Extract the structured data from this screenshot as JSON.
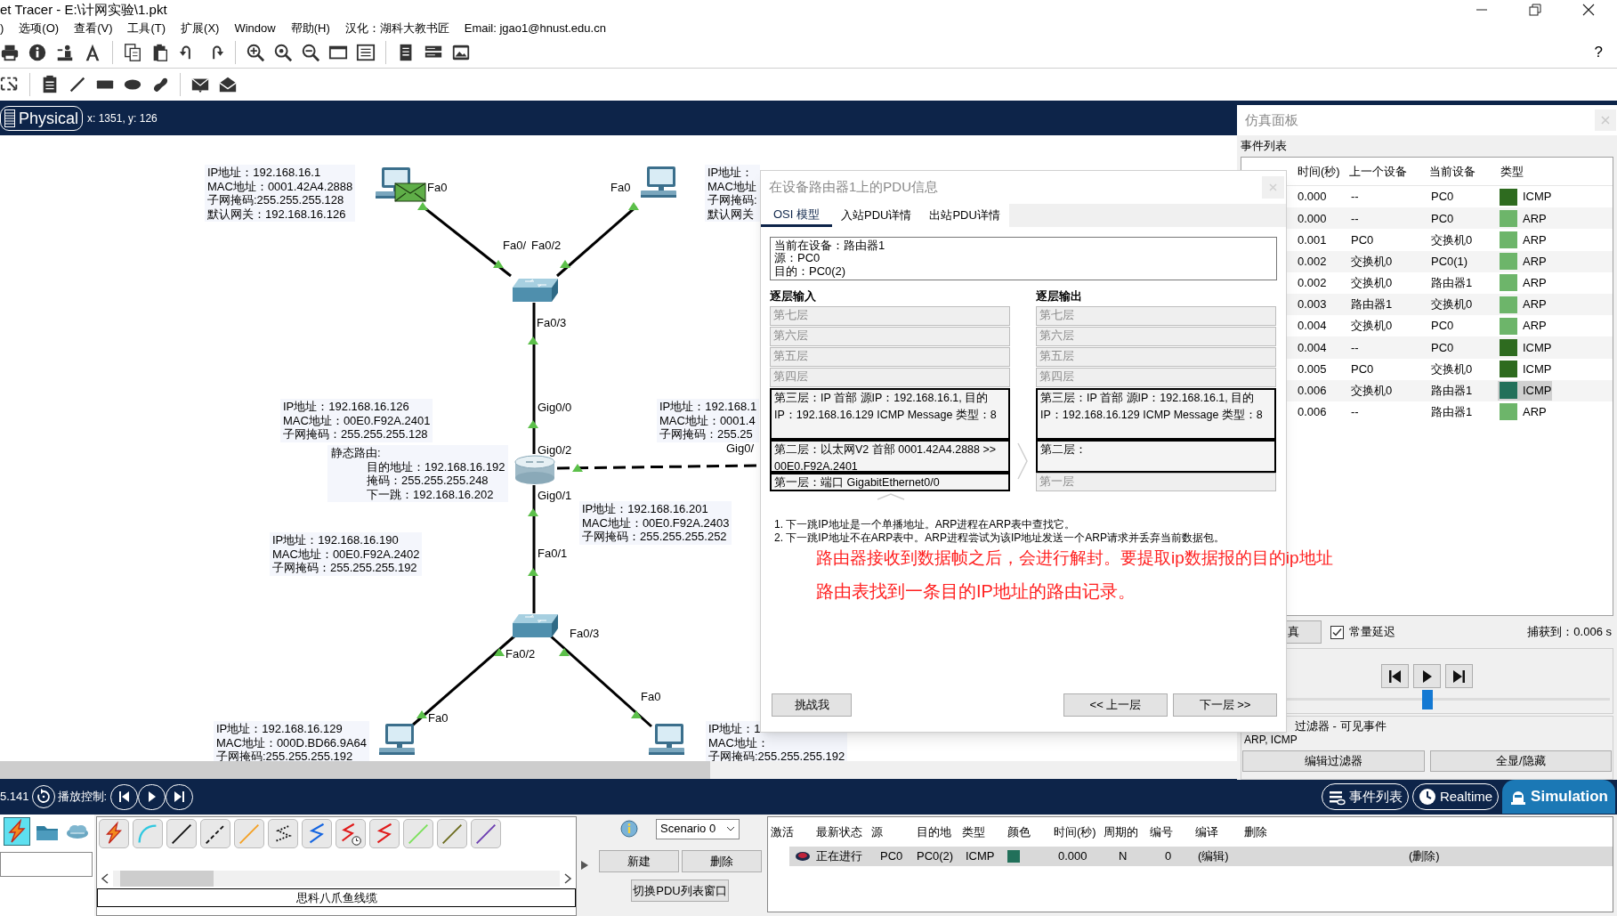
{
  "title_bar": {
    "title": "et Tracer - E:\\计网实验\\1.pkt"
  },
  "menu": [
    ")",
    "选项(O)",
    "查看(V)",
    "工具(T)",
    "扩展(X)",
    "Window",
    "帮助(H)",
    "汉化：湖科大教书匠",
    "Email: jgao1@hnust.edu.cn"
  ],
  "help": "?",
  "workspace_bar": {
    "mode": "Physical",
    "coords": "x: 1351, y: 126"
  },
  "topology": {
    "devices": [
      {
        "kind": "pc",
        "packet": true
      },
      {
        "kind": "pc"
      },
      {
        "kind": "switch"
      },
      {
        "kind": "router"
      },
      {
        "kind": "switch"
      },
      {
        "kind": "pc"
      },
      {
        "kind": "pc"
      }
    ],
    "port_labels": [
      "Fa0",
      "Fa0",
      "Fa0/",
      "Fa0/2",
      "Fa0/3",
      "Gig0/0",
      "Gig0/2",
      "Gig0/1",
      "Fa0/1",
      "Fa0/3",
      "Fa0/2",
      "Fa0",
      "Fa0",
      "Gig0/"
    ],
    "info_labels": [
      {
        "lines": [
          "IP地址：192.168.16.1",
          "MAC地址：0001.42A4.2888",
          "子网掩码:255.255.255.128",
          "默认网关：192.168.16.126"
        ]
      },
      {
        "lines": [
          "IP地址：",
          "MAC地址",
          "子网掩码:",
          "默认网关"
        ]
      },
      {
        "lines": [
          "IP地址：192.168.16.126",
          "MAC地址：00E0.F92A.2401",
          "子网掩码：255.255.255.128"
        ]
      },
      {
        "lines": [
          "IP地址：192.168.1",
          "MAC地址：0001.4",
          "子网掩码：255.25"
        ]
      },
      {
        "lines": [
          "IP地址：192.168.16.190",
          "MAC地址：00E0.F92A.2402",
          "子网掩码：255.255.255.192"
        ]
      },
      {
        "lines": [
          "IP地址：192.168.16.201",
          "MAC地址：00E0.F92A.2403",
          "子网掩码：255.255.255.252"
        ]
      },
      {
        "lines": [
          "IP地址：192.168.16.129",
          "MAC地址：000D.BD66.9A64",
          "子网掩码:255.255.255.192"
        ]
      },
      {
        "lines": [
          "IP地址：1",
          "MAC地址：",
          "子网掩码:255.255.255.192"
        ]
      }
    ],
    "static_route": {
      "heading": "静态路由:",
      "lines": [
        "目的地址：192.168.16.192",
        "掩码：255.255.255.248",
        "下一跳：192.168.16.202"
      ]
    }
  },
  "pdu_dialog": {
    "title": "在设备路由器1上的PDU信息",
    "tabs": [
      {
        "label": "OSI 模型",
        "selected": true
      },
      {
        "label": "入站PDU详情",
        "selected": false
      },
      {
        "label": "出站PDU详情",
        "selected": false
      }
    ],
    "info": [
      "当前在设备：路由器1",
      "源：PC0",
      "目的：PC0(2)"
    ],
    "in_title": "逐层输入",
    "in_layers": [
      {
        "text": "第七层",
        "active": false
      },
      {
        "text": "第六层",
        "active": false
      },
      {
        "text": "第五层",
        "active": false
      },
      {
        "text": "第四层",
        "active": false
      },
      {
        "text": "第三层：IP 首部 源IP：192.168.16.1, 目的IP：192.168.16.129 ICMP Message 类型：8",
        "active": true
      },
      {
        "text": "第二层：以太网V2 首部 0001.42A4.2888 >> 00E0.F92A.2401",
        "active": true
      },
      {
        "text": "第一层：端口 GigabitEthernet0/0",
        "active": true
      }
    ],
    "out_title": "逐层输出",
    "out_layers": [
      {
        "text": "第七层",
        "active": false
      },
      {
        "text": "第六层",
        "active": false
      },
      {
        "text": "第五层",
        "active": false
      },
      {
        "text": "第四层",
        "active": false
      },
      {
        "text": "第三层：IP 首部 源IP：192.168.16.1, 目的IP：192.168.16.129 ICMP Message 类型：8",
        "active": true
      },
      {
        "text": "第二层：",
        "active": true
      },
      {
        "text": "第一层",
        "active": false
      }
    ],
    "notes": [
      "1. 下一跳IP地址是一个单播地址。ARP进程在ARP表中查找它。",
      "2. 下一跳IP地址不在ARP表中。ARP进程尝试为该IP地址发送一个ARP请求并丢弃当前数据包。"
    ],
    "challenge_button": "挑战我",
    "prev_button": "<< 上一层",
    "next_button": "下一层 >>"
  },
  "annotations": [
    "路由器接收到数据帧之后，会进行解封。要提取ip数据报的目的ip地址",
    "路由表找到一条目的IP地址的路由记录。"
  ],
  "simulation_panel": {
    "title": "仿真面板",
    "section": "事件列表",
    "columns": [
      "时间(秒)",
      "上一个设备",
      "当前设备",
      "类型"
    ],
    "events": [
      {
        "time": "0.000",
        "last": "--",
        "at": "PC0",
        "type": "ICMP",
        "color": "#2e6b1f",
        "selected": false
      },
      {
        "time": "0.000",
        "last": "--",
        "at": "PC0",
        "type": "ARP",
        "color": "#6db56a",
        "selected": false
      },
      {
        "time": "0.001",
        "last": "PC0",
        "at": "交换机0",
        "type": "ARP",
        "color": "#6db56a",
        "selected": false
      },
      {
        "time": "0.002",
        "last": "交换机0",
        "at": "PC0(1)",
        "type": "ARP",
        "color": "#6db56a",
        "selected": false
      },
      {
        "time": "0.002",
        "last": "交换机0",
        "at": "路由器1",
        "type": "ARP",
        "color": "#6db56a",
        "selected": false
      },
      {
        "time": "0.003",
        "last": "路由器1",
        "at": "交换机0",
        "type": "ARP",
        "color": "#6db56a",
        "selected": false
      },
      {
        "time": "0.004",
        "last": "交换机0",
        "at": "PC0",
        "type": "ARP",
        "color": "#6db56a",
        "selected": false
      },
      {
        "time": "0.004",
        "last": "--",
        "at": "PC0",
        "type": "ICMP",
        "color": "#2e6b1f",
        "selected": false
      },
      {
        "time": "0.005",
        "last": "PC0",
        "at": "交换机0",
        "type": "ICMP",
        "color": "#2e6b1f",
        "selected": false
      },
      {
        "time": "0.006",
        "last": "交换机0",
        "at": "路由器1",
        "type": "ICMP",
        "color": "#22705a",
        "selected": true
      },
      {
        "time": "0.006",
        "last": "--",
        "at": "路由器1",
        "type": "ARP",
        "color": "#6db56a",
        "selected": false
      }
    ],
    "reset_button": "真",
    "constant_delay": {
      "label": "常量延迟",
      "checked": true
    },
    "captured": "捕获到：0.006 s",
    "playback": {
      "level": 0.5
    },
    "filter": {
      "title": "过滤器 - 可见事件",
      "value": "ARP, ICMP",
      "buttons": [
        "编辑过滤器",
        "全显/隐藏"
      ]
    }
  },
  "bottom_bar": {
    "time": "5.141",
    "playback_label": "播放控制:",
    "mode_buttons": [
      {
        "label": "事件列表",
        "kind": "events",
        "selected": false
      },
      {
        "label": "Realtime",
        "kind": "realtime",
        "selected": false
      },
      {
        "label": "Simulation",
        "kind": "simulation",
        "selected": true
      }
    ]
  },
  "device_panel": {
    "categories": [
      {
        "kind": "connections",
        "selected": true
      },
      {
        "kind": "folder",
        "selected": false
      },
      {
        "kind": "cloud",
        "selected": false
      }
    ],
    "caption": "思科八爪鱼线缆"
  },
  "scenario": {
    "select": "Scenario 0",
    "new_button": "新建",
    "delete_button": "删除",
    "toggle_button": "切换PDU列表窗口"
  },
  "pdu_list": {
    "columns": [
      "激活",
      "最新状态",
      "源",
      "目的地",
      "类型",
      "颜色",
      "时间(秒)",
      "周期的",
      "编号",
      "编译",
      "删除"
    ],
    "rows": [
      {
        "status": "正在进行",
        "source": "PC0",
        "destination": "PC0(2)",
        "type": "ICMP",
        "color": "#22705a",
        "time": "0.000",
        "periodic": "N",
        "number": "0",
        "edit": "(编辑)",
        "delete": "(删除)",
        "selected": true
      }
    ]
  }
}
